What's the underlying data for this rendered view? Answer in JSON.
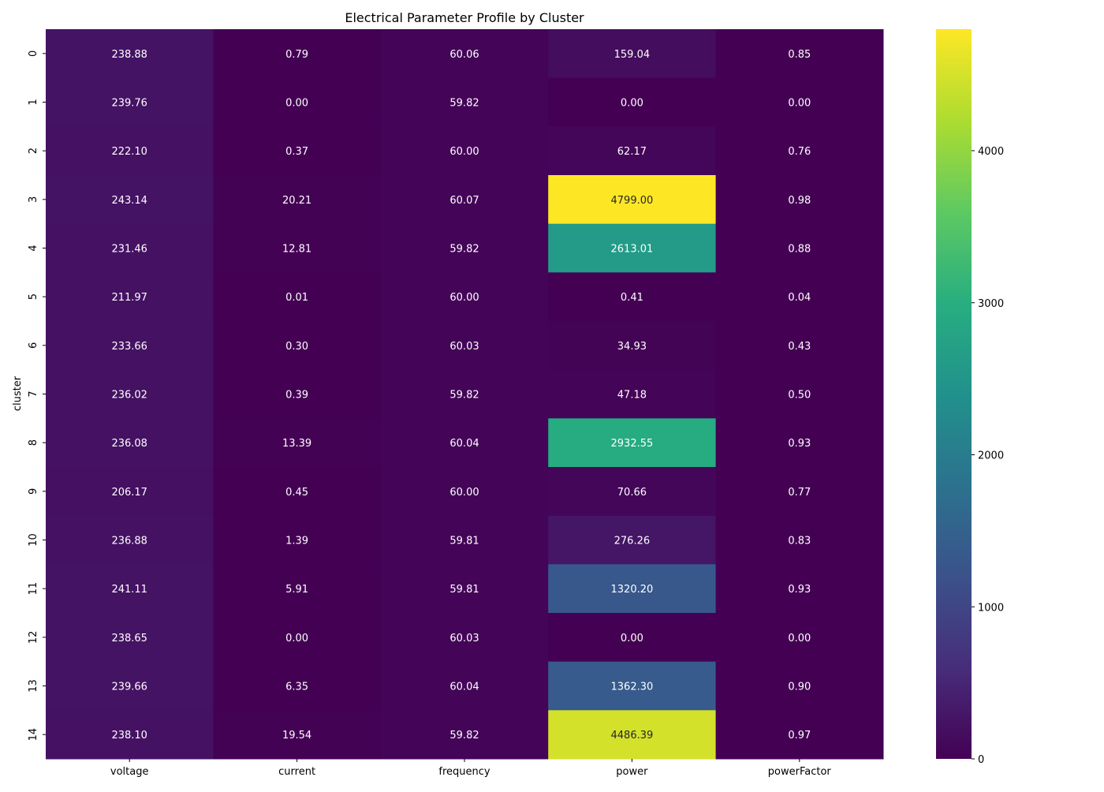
{
  "chart_data": {
    "type": "heatmap",
    "title": "Electrical Parameter Profile by Cluster",
    "xlabel": "",
    "ylabel": "cluster",
    "columns": [
      "voltage",
      "current",
      "frequency",
      "power",
      "powerFactor"
    ],
    "rows": [
      "0",
      "1",
      "2",
      "3",
      "4",
      "5",
      "6",
      "7",
      "8",
      "9",
      "10",
      "11",
      "12",
      "13",
      "14"
    ],
    "values": [
      [
        238.88,
        0.79,
        60.06,
        159.04,
        0.85
      ],
      [
        239.76,
        0.0,
        59.82,
        0.0,
        0.0
      ],
      [
        222.1,
        0.37,
        60.0,
        62.17,
        0.76
      ],
      [
        243.14,
        20.21,
        60.07,
        4799.0,
        0.98
      ],
      [
        231.46,
        12.81,
        59.82,
        2613.01,
        0.88
      ],
      [
        211.97,
        0.01,
        60.0,
        0.41,
        0.04
      ],
      [
        233.66,
        0.3,
        60.03,
        34.93,
        0.43
      ],
      [
        236.02,
        0.39,
        59.82,
        47.18,
        0.5
      ],
      [
        236.08,
        13.39,
        60.04,
        2932.55,
        0.93
      ],
      [
        206.17,
        0.45,
        60.0,
        70.66,
        0.77
      ],
      [
        236.88,
        1.39,
        59.81,
        276.26,
        0.83
      ],
      [
        241.11,
        5.91,
        59.81,
        1320.2,
        0.93
      ],
      [
        238.65,
        0.0,
        60.03,
        0.0,
        0.0
      ],
      [
        239.66,
        6.35,
        60.04,
        1362.3,
        0.9
      ],
      [
        238.1,
        19.54,
        59.82,
        4486.39,
        0.97
      ]
    ],
    "colorbar": {
      "colormap": "viridis",
      "range": [
        0,
        4799.0
      ],
      "ticks": [
        0,
        1000,
        2000,
        3000,
        4000
      ]
    },
    "annotation_format": "2 decimals",
    "grid": false
  }
}
